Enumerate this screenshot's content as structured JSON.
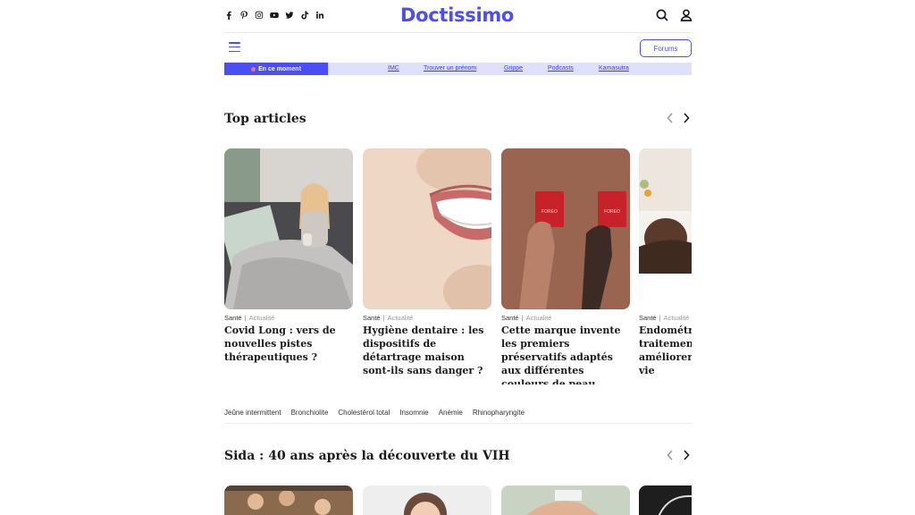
{
  "brand": {
    "logo": "Doctissimo",
    "accent": "#4b4ef4"
  },
  "header": {
    "socials": [
      "facebook-icon",
      "pinterest-icon",
      "instagram-icon",
      "youtube-icon",
      "twitter-icon",
      "tiktok-icon",
      "linkedin-icon"
    ],
    "icons": [
      "search-icon",
      "user-icon"
    ],
    "forums_label": "Forums"
  },
  "trending": {
    "label": "En ce moment",
    "links": [
      "IMC",
      "Trouver un prénom",
      "Grippe",
      "Podcasts",
      "Kamasutra"
    ]
  },
  "top_articles": {
    "title": "Top articles",
    "cards": [
      {
        "category": "Santé",
        "subcategory": "Actualité",
        "title": "Covid Long : vers de nouvelles pistes thérapeutiques ?"
      },
      {
        "category": "Santé",
        "subcategory": "Actualité",
        "title": "Hygiène dentaire : les dispositifs de détartrage maison sont-ils sans danger ?"
      },
      {
        "category": "Santé",
        "subcategory": "Actualité",
        "title": "Cette marque invente les premiers préservatifs adaptés aux différentes couleurs de peau"
      },
      {
        "category": "Santé",
        "subcategory": "Actualité",
        "title": "Endométriose : un traitement réussit à améliorer la qualité de vie"
      }
    ]
  },
  "tags": [
    "Jeûne intermittent",
    "Bronchiolite",
    "Cholestérol total",
    "Insomnie",
    "Anémie",
    "Rhinopharyngite"
  ],
  "section2": {
    "title": "Sida : 40 ans après la découverte du VIH"
  }
}
